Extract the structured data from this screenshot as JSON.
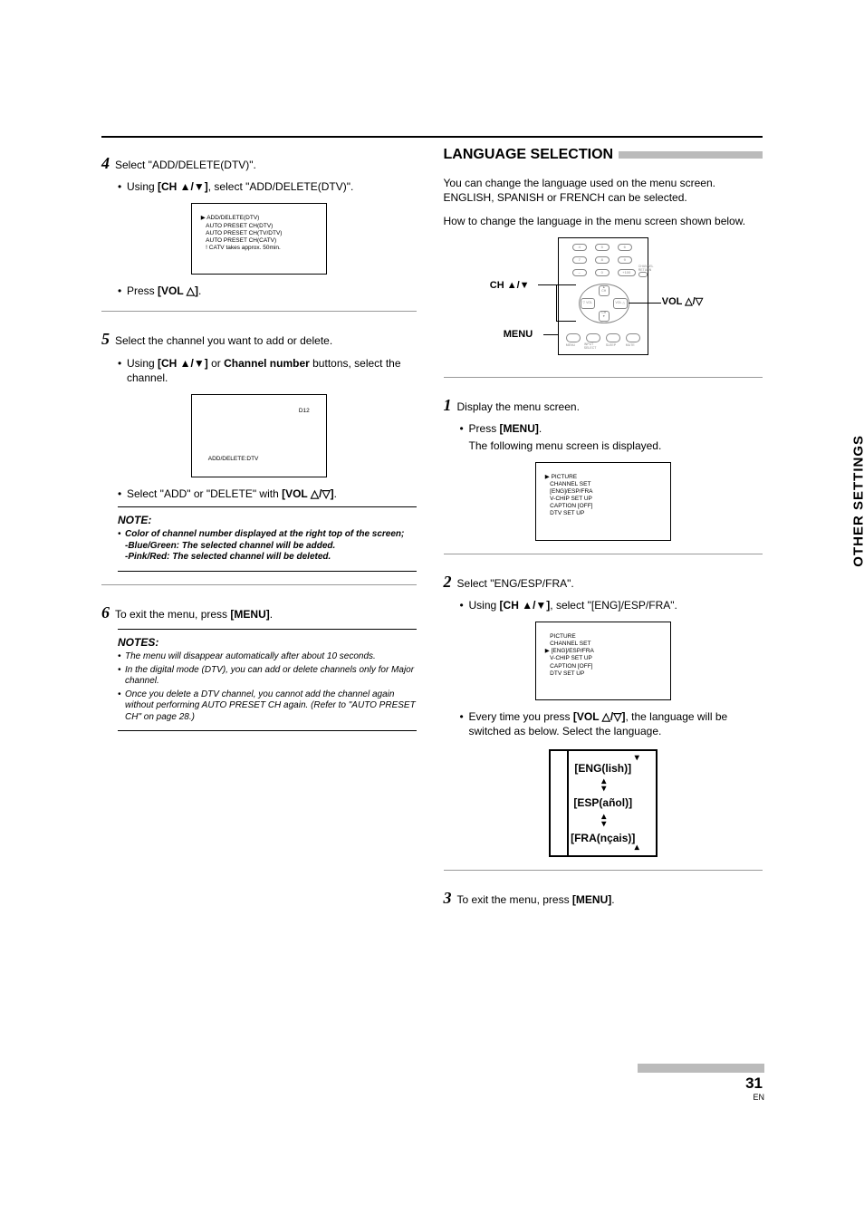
{
  "left": {
    "step4": {
      "num": "4",
      "title": "Select \"ADD/DELETE(DTV)\".",
      "bullet1": "Using [CH ▲/▼], select \"ADD/DELETE(DTV)\".",
      "menu": {
        "r1": "ADD/DELETE(DTV)",
        "r2": "AUTO PRESET CH(DTV)",
        "r3": "AUTO PRESET CH(TV/DTV)",
        "r4": "AUTO PRESET CH(CATV)",
        "r5": "! CATV takes approx. 50min."
      },
      "bullet2_pre": "Press ",
      "bullet2_bold": "[VOL △]",
      "bullet2_post": "."
    },
    "step5": {
      "num": "5",
      "title": "Select the channel you want to add or delete.",
      "bullet1_pre": "Using ",
      "bullet1_bold1": "[CH ▲/▼]",
      "bullet1_mid": " or ",
      "bullet1_bold2": "Channel number",
      "bullet1_post": " buttons, select the channel.",
      "screen_d12": "D12",
      "screen_ad": "ADD/DELETE:DTV",
      "bullet2_pre": "Select \"ADD\" or \"DELETE\" with ",
      "bullet2_bold": "[VOL △/▽]",
      "bullet2_post": ".",
      "note_title": "NOTE:",
      "note_item1": "Color of channel number displayed at the right top of the screen;",
      "note_sub1": "-Blue/Green: The selected channel will be added.",
      "note_sub2": "-Pink/Red: The selected channel will be deleted."
    },
    "step6": {
      "num": "6",
      "title_pre": "To exit the menu, press ",
      "title_bold": "[MENU]",
      "title_post": ".",
      "notes_title": "NOTES:",
      "n1": "The menu will disappear automatically after about 10 seconds.",
      "n2": "In the digital mode (DTV), you can add or delete channels only for Major channel.",
      "n3": "Once you delete a DTV channel, you cannot add the channel again without performing AUTO PRESET CH again. (Refer to \"AUTO PRESET CH\" on page 28.)"
    }
  },
  "right": {
    "section_title": "LANGUAGE SELECTION",
    "intro1": "You can change the language used on the menu screen. ENGLISH, SPANISH or FRENCH can be selected.",
    "intro2": "How to change the language in the menu screen shown below.",
    "remote": {
      "ch_label": "CH ▲/▼",
      "menu_label": "MENU",
      "vol_label": "VOL △/▽",
      "btn4": "4",
      "btn5": "5",
      "btn6": "6",
      "btn7": "7",
      "btn8": "8",
      "btn9": "9",
      "btn0": "0",
      "btn100": "+100",
      "btn_min": "–",
      "btn_chret": "CHANNEL\nRETURN",
      "dp_ch_up": "▲\nCH",
      "dp_ch_dn": "CH\n▼",
      "dp_vol_l": "▽ VOL",
      "dp_vol_r": "VOL △",
      "b_menu": "MENU",
      "b_input": "INPUT\nSELECT",
      "b_sleep": "SLEEP",
      "b_mute": "MUTE"
    },
    "step1": {
      "num": "1",
      "title": "Display the menu screen.",
      "bullet_pre": "Press ",
      "bullet_bold": "[MENU]",
      "bullet_post": ".",
      "line2": "The following menu screen is displayed.",
      "menu": {
        "r1": "PICTURE",
        "r2": "CHANNEL SET",
        "r3": "[ENG]/ESP/FRA",
        "r4": "V-CHIP SET UP",
        "r5": "CAPTION [OFF]",
        "r6": "DTV SET UP"
      }
    },
    "step2": {
      "num": "2",
      "title": "Select \"ENG/ESP/FRA\".",
      "bullet_pre": "Using ",
      "bullet_bold": "[CH ▲/▼]",
      "bullet_post": ", select \"[ENG]/ESP/FRA\".",
      "menu": {
        "r1": "PICTURE",
        "r2": "CHANNEL SET",
        "r3": "[ENG]/ESP/FRA",
        "r4": "V-CHIP SET UP",
        "r5": "CAPTION [OFF]",
        "r6": "DTV SET UP"
      },
      "bullet2_pre": "Every time you press ",
      "bullet2_bold": "[VOL △/▽]",
      "bullet2_post": ", the language will be switched as below. Select the language.",
      "lang1": "[ENG(lish)]",
      "lang2": "[ESP(añol)]",
      "lang3": "[FRA(nçais)]"
    },
    "step3": {
      "num": "3",
      "title_pre": "To exit the menu, press ",
      "title_bold": "[MENU]",
      "title_post": "."
    }
  },
  "side_label": "OTHER SETTINGS",
  "page_num": "31",
  "page_en": "EN"
}
